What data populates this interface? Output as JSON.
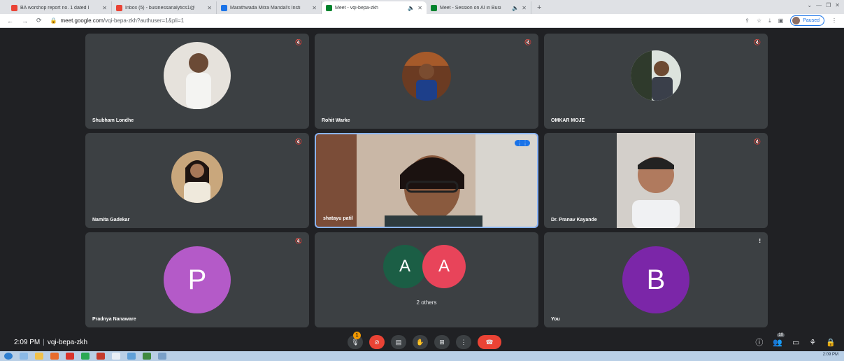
{
  "browser": {
    "tabs": [
      {
        "title": "BA worshop report no. 1 dated I",
        "icon": "gmail-icon",
        "color": "#ea4335"
      },
      {
        "title": "Inbox (5) - businessanalytics1@",
        "icon": "gmail-icon",
        "color": "#ea4335"
      },
      {
        "title": "Marathwada Mitra Mandal's Insti",
        "icon": "doc-icon",
        "color": "#1a73e8"
      },
      {
        "title": "Meet - vqi-bepa-zkh",
        "icon": "meet-icon",
        "color": "#00832d",
        "active": true
      },
      {
        "title": "Meet - Session on AI in Busi",
        "icon": "meet-icon",
        "color": "#00832d"
      }
    ],
    "url_host": "meet.google.com",
    "url_path": "/vqi-bepa-zkh?authuser=1&pli=1",
    "profile_status": "Paused"
  },
  "tiles": [
    {
      "name": "Shubham Londhe",
      "type": "photo",
      "color": "#d9d2c7"
    },
    {
      "name": "Rohit Warke",
      "type": "photo",
      "color": "#6b3b22"
    },
    {
      "name": "OMKAR MOJE",
      "type": "photo",
      "color": "#2f3a2c"
    },
    {
      "name": "Namita Gadekar",
      "type": "photo",
      "color": "#7a5a3c"
    },
    {
      "name": "shatayu patil",
      "type": "video",
      "color": "#b79f8a"
    },
    {
      "name": "Dr. Pranav Kayande",
      "type": "video",
      "color": "#c9c4bf"
    },
    {
      "name": "Pradnya Nanaware",
      "type": "letter",
      "letter": "P",
      "color": "#b45ac8"
    },
    {
      "name": "2 others",
      "type": "others",
      "letters": [
        "A",
        "A"
      ],
      "colors": [
        "#1b5e45",
        "#e8445a"
      ]
    },
    {
      "name": "You",
      "type": "letter",
      "letter": "B",
      "color": "#7b26a8"
    }
  ],
  "meeting": {
    "time": "2:09 PM",
    "code": "vqi-bepa-zkh",
    "reactions_badge": "1",
    "participant_count": "10"
  },
  "taskbar": {
    "clock": "2:09 PM"
  }
}
